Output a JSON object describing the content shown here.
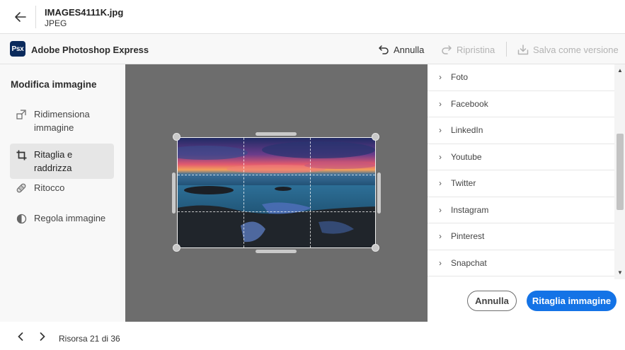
{
  "header": {
    "file_name": "IMAGES4111K.jpg",
    "file_type": "JPEG",
    "back_icon": "arrow-left-icon"
  },
  "appbar": {
    "app_name": "Adobe Photoshop Express",
    "logo_text": "Psx",
    "undo_label": "Annulla",
    "redo_label": "Ripristina",
    "save_version_label": "Salva come versione"
  },
  "left_panel": {
    "title": "Modifica immagine",
    "tools": [
      {
        "label": "Ridimensiona immagine",
        "icon": "resize-icon",
        "active": false
      },
      {
        "label": "Ritaglia e raddrizza",
        "icon": "crop-icon",
        "active": true
      },
      {
        "label": "Ritocco",
        "icon": "bandage-icon",
        "active": false
      },
      {
        "label": "Regola immagine",
        "icon": "adjust-icon",
        "active": false
      }
    ]
  },
  "right_panel": {
    "presets": [
      {
        "label": "Foto"
      },
      {
        "label": "Facebook"
      },
      {
        "label": "LinkedIn"
      },
      {
        "label": "Youtube"
      },
      {
        "label": "Twitter"
      },
      {
        "label": "Instagram"
      },
      {
        "label": "Pinterest"
      },
      {
        "label": "Snapchat"
      }
    ],
    "cancel_label": "Annulla",
    "crop_label": "Ritaglia immagine"
  },
  "footer": {
    "resource_label": "Risorsa 21 di 36"
  },
  "colors": {
    "accent": "#1473e6",
    "canvas_bg": "#6d6d6d",
    "logo_bg": "#0a2a5c"
  }
}
